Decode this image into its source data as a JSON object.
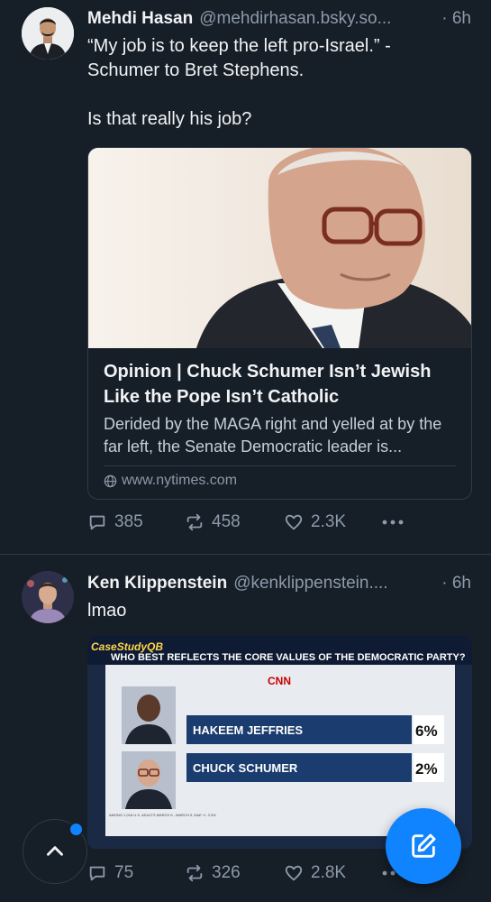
{
  "feed": [
    {
      "author": {
        "display_name": "Mehdi Hasan",
        "handle": "@mehdirhasan.bsky.so...",
        "avatar_icon": "person-in-suit-avatar"
      },
      "timestamp": "· 6h",
      "text_lines": [
        "“My job is to keep the left pro-Israel.” -",
        "Schumer to Bret Stephens.",
        "",
        "Is that really his job?"
      ],
      "link_card": {
        "image_icon": "chuck-schumer-portrait-photo",
        "title": "Opinion | Chuck Schumer Isn’t Jewish Like the Pope Isn’t Catholic",
        "description": "Derided by the MAGA right and yelled at by the far left, the Senate Democratic leader is...",
        "domain": "www.nytimes.com"
      },
      "actions": {
        "replies": "385",
        "reposts": "458",
        "likes": "2.3K",
        "more_icon": "more-options-icon"
      }
    },
    {
      "author": {
        "display_name": "Ken Klippenstein",
        "handle": "@kenklippenstein....",
        "avatar_icon": "person-portrait-avatar"
      },
      "timestamp": "· 6h",
      "text_lines": [
        "lmao"
      ],
      "embed": {
        "logo": "CaseStudyQB",
        "headline": "WHO BEST REFLECTS THE CORE VALUES OF THE DEMOCRATIC PARTY?",
        "network": "CNN",
        "rows": [
          {
            "name": "HAKEEM JEFFRIES",
            "pct": "6%"
          },
          {
            "name": "CHUCK SCHUMER",
            "pct": "2%"
          }
        ],
        "fine_print": "AMONG 1,018 U.S. ADULTS MARCH 6 - MARCH 9, MoE +/- 3.3%"
      },
      "actions": {
        "replies": "75",
        "reposts": "326",
        "likes": "2.8K",
        "more_icon": "more-options-icon"
      }
    }
  ],
  "floating": {
    "scroll_top_icon": "chevron-up-icon",
    "compose_icon": "compose-pencil-icon"
  },
  "colors": {
    "background": "#161e27",
    "accent": "#1083fe",
    "muted": "#8c9aab",
    "text": "#f1f3f5"
  }
}
